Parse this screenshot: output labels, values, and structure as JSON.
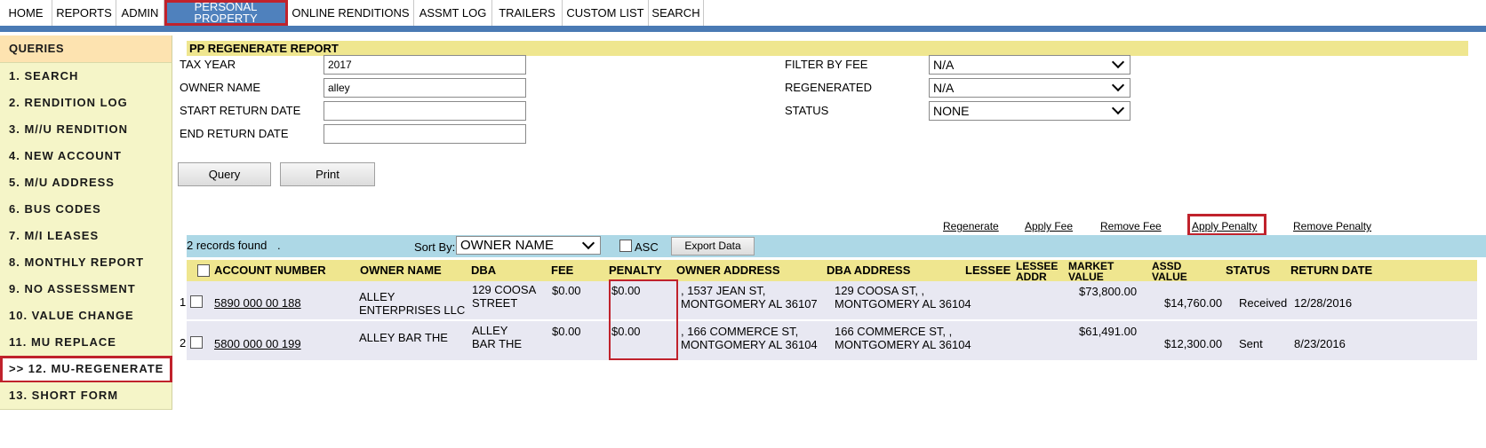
{
  "nav": {
    "tabs": [
      "HOME",
      "REPORTS",
      "ADMIN",
      "PERSONAL PROPERTY",
      "ONLINE RENDITIONS",
      "ASSMT LOG",
      "TRAILERS",
      "CUSTOM LIST",
      "SEARCH"
    ],
    "active": "PERSONAL PROPERTY"
  },
  "sidebar": {
    "header": "QUERIES",
    "items": [
      "1. SEARCH",
      "2. RENDITION LOG",
      "3. M//U RENDITION",
      "4. NEW ACCOUNT",
      "5. M/U ADDRESS",
      "6. BUS CODES",
      "7. M/I LEASES",
      "8. MONTHLY REPORT",
      "9. NO ASSESSMENT",
      "10. VALUE CHANGE",
      "11. MU REPLACE",
      ">> 12. MU-REGENERATE",
      "13. SHORT FORM"
    ],
    "active": ">> 12. MU-REGENERATE"
  },
  "report": {
    "title": "PP REGENERATE REPORT",
    "fields": {
      "tax_year": {
        "label": "TAX YEAR",
        "value": "2017"
      },
      "owner_name": {
        "label": "OWNER NAME",
        "value": "alley"
      },
      "start_return_date": {
        "label": "START RETURN DATE",
        "value": ""
      },
      "end_return_date": {
        "label": "END RETURN DATE",
        "value": ""
      },
      "filter_by_fee": {
        "label": "FILTER BY FEE",
        "value": "N/A"
      },
      "regenerated": {
        "label": "REGENERATED",
        "value": "N/A"
      },
      "status": {
        "label": "STATUS",
        "value": "NONE"
      }
    },
    "buttons": {
      "query": "Query",
      "print": "Print"
    },
    "actions": [
      "Regenerate",
      "Apply Fee",
      "Remove Fee",
      "Apply Penalty",
      "Remove Penalty"
    ]
  },
  "results": {
    "count_text": "2 records found",
    "count_suffix": ".",
    "sort_label": "Sort By:",
    "sort_value": "OWNER NAME",
    "asc_label": "ASC",
    "export_label": "Export Data",
    "columns": [
      "ACCOUNT NUMBER",
      "OWNER NAME",
      "DBA",
      "FEE",
      "PENALTY",
      "OWNER ADDRESS",
      "DBA ADDRESS",
      "LESSEE",
      "LESSEE ADDR",
      "MARKET VALUE",
      "ASSD VALUE",
      "STATUS",
      "RETURN DATE"
    ],
    "rows": [
      {
        "index": "1",
        "account": "5890 000 00 188",
        "owner": "ALLEY ENTERPRISES LLC",
        "dba": "129 COOSA STREET",
        "fee": "$0.00",
        "penalty": "$0.00",
        "owner_addr": ", 1537 JEAN ST, MONTGOMERY AL 36107",
        "dba_addr": "129 COOSA ST, , MONTGOMERY AL 36104",
        "lessee": "",
        "lessee_addr": "",
        "market": "$73,800.00",
        "assd": "$14,760.00",
        "status": "Received",
        "return_date": "12/28/2016"
      },
      {
        "index": "2",
        "account": "5800 000 00 199",
        "owner": "ALLEY BAR THE",
        "dba": "ALLEY BAR THE",
        "fee": "$0.00",
        "penalty": "$0.00",
        "owner_addr": ", 166 COMMERCE ST, MONTGOMERY AL 36104",
        "dba_addr": "166 COMMERCE ST, , MONTGOMERY AL 36104",
        "lessee": "",
        "lessee_addr": "",
        "market": "$61,491.00",
        "assd": "$12,300.00",
        "status": "Sent",
        "return_date": "8/23/2016"
      }
    ]
  },
  "colors": {
    "nav_active": "#4f81bd",
    "highlight": "#c0222c",
    "header_bg": "#efe68f",
    "results_bar": "#add8e6",
    "row_bg": "#e8e8f2"
  }
}
